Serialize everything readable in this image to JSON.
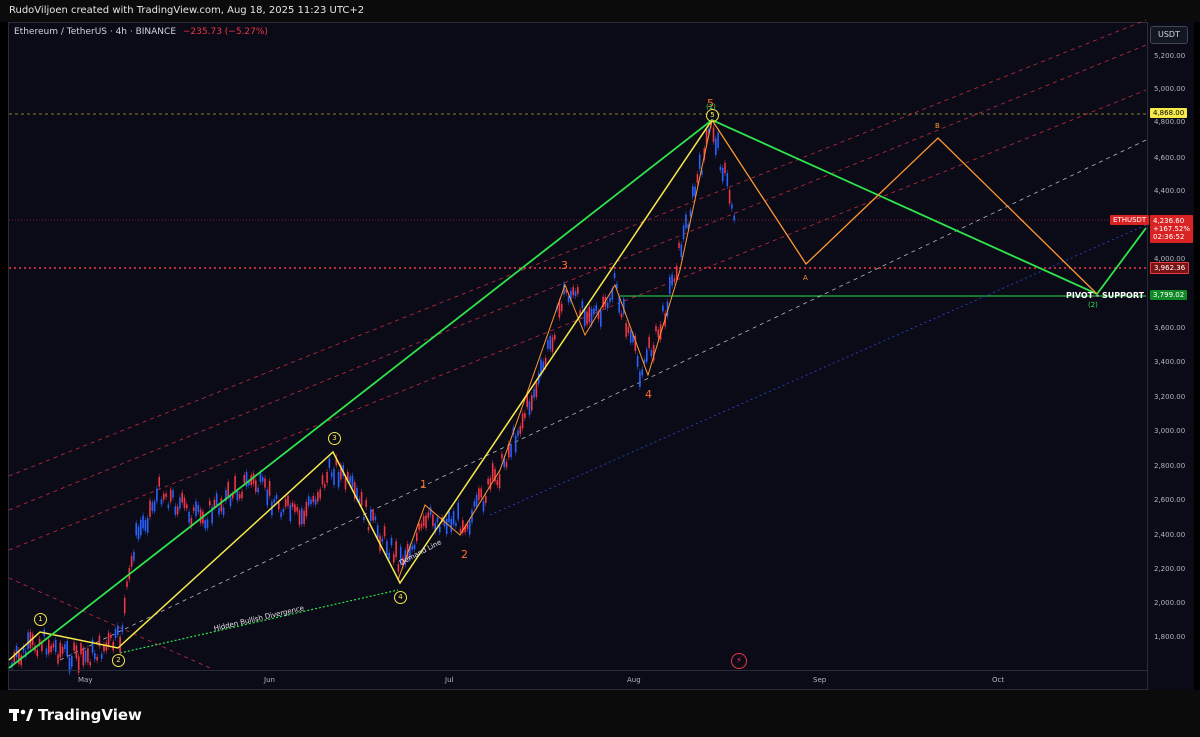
{
  "header": {
    "credit": "RudoViljoen created with TradingView.com, Aug 18, 2025 11:23 UTC+2"
  },
  "symbol": {
    "name": "Ethereum / TetherUS · 4h · BINANCE",
    "change": "−235.73 (−5.27%)"
  },
  "axis": {
    "currency": "USDT",
    "price_ticks": [
      "5,200.00",
      "5,000.00",
      "4,800.00",
      "4,600.00",
      "4,400.00",
      "4,200.00",
      "4,000.00",
      "3,800.00",
      "3,600.00",
      "3,400.00",
      "3,200.00",
      "3,000.00",
      "2,800.00",
      "2,600.00",
      "2,400.00",
      "2,200.00",
      "2,000.00",
      "1,800.00"
    ],
    "time_ticks": [
      "May",
      "Jun",
      "Jul",
      "Aug",
      "Sep",
      "Oct"
    ]
  },
  "labels": {
    "level_yellow": "4,868.00",
    "level_red": "3,962.36",
    "level_green": "3,799.02",
    "ticker": "ETHUSDT",
    "current_price": "4,236.60",
    "current_pct": "+167.52%",
    "countdown": "02:36:52",
    "pivot": "PIVOT - SUPPORT"
  },
  "annotations": {
    "wave_orange": [
      "5",
      "3",
      "4",
      "1",
      "2"
    ],
    "wave_yellow": [
      "1",
      "2",
      "3",
      "4",
      "5"
    ],
    "wave_green": [
      "(1)",
      "(2)"
    ],
    "abc": [
      "A",
      "B"
    ],
    "demand_line": "Demand Line",
    "hidden_div": "Hidden Bullish Divergence"
  },
  "footer": {
    "brand": "TradingView"
  },
  "colors": {
    "background": "#0b0a17",
    "up": "#2962ff",
    "down": "#f23645",
    "wave": "#f7ea4a",
    "green": "#2ee54b",
    "orange": "#ff9832"
  }
}
